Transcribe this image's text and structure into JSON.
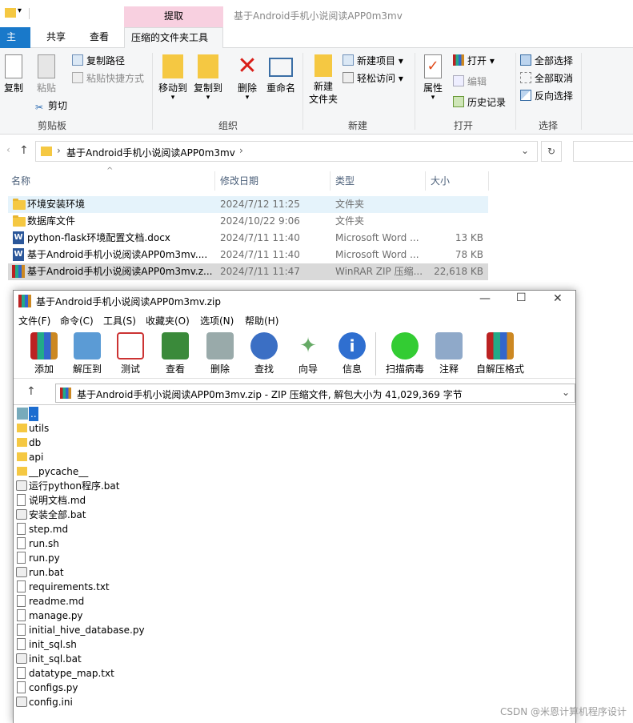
{
  "explorer": {
    "context_tab": "提取",
    "window_title": "基于Android手机小说阅读APP0m3mv",
    "tabs": [
      "主页",
      "共享",
      "查看",
      "压缩的文件夹工具"
    ],
    "ribbon": {
      "clipboard": {
        "copy": "复制",
        "paste": "粘贴",
        "copy_path": "复制路径",
        "paste_shortcut": "粘贴快捷方式",
        "cut": "剪切",
        "label": "剪贴板"
      },
      "organize": {
        "move_to": "移动到",
        "copy_to": "复制到",
        "delete": "删除",
        "rename": "重命名",
        "label": "组织"
      },
      "new": {
        "new_folder_line1": "新建",
        "new_folder_line2": "文件夹",
        "new_item": "新建项目",
        "easy_access": "轻松访问",
        "label": "新建"
      },
      "open": {
        "properties": "属性",
        "open": "打开",
        "edit": "编辑",
        "history": "历史记录",
        "label": "打开"
      },
      "select": {
        "select_all": "全部选择",
        "select_none": "全部取消",
        "invert": "反向选择",
        "label": "选择"
      }
    },
    "address": "基于Android手机小说阅读APP0m3mv",
    "columns": {
      "name": "名称",
      "date": "修改日期",
      "type": "类型",
      "size": "大小"
    },
    "files": [
      {
        "name": "环境安装环境",
        "date": "2024/7/12 11:25",
        "type": "文件夹",
        "size": "",
        "icon": "folder"
      },
      {
        "name": "数据库文件",
        "date": "2024/10/22 9:06",
        "type": "文件夹",
        "size": "",
        "icon": "folder"
      },
      {
        "name": "python-flask环境配置文档.docx",
        "date": "2024/7/11 11:40",
        "type": "Microsoft Word ...",
        "size": "13 KB",
        "icon": "word"
      },
      {
        "name": "基于Android手机小说阅读APP0m3mv....",
        "date": "2024/7/11 11:40",
        "type": "Microsoft Word ...",
        "size": "78 KB",
        "icon": "word"
      },
      {
        "name": "基于Android手机小说阅读APP0m3mv.z...",
        "date": "2024/7/11 11:47",
        "type": "WinRAR ZIP 压缩...",
        "size": "22,618 KB",
        "icon": "rar"
      }
    ]
  },
  "rar": {
    "title": "基于Android手机小说阅读APP0m3mv.zip",
    "menu": [
      "文件(F)",
      "命令(C)",
      "工具(S)",
      "收藏夹(O)",
      "选项(N)",
      "帮助(H)"
    ],
    "toolbar": [
      "添加",
      "解压到",
      "测试",
      "查看",
      "删除",
      "查找",
      "向导",
      "信息",
      "扫描病毒",
      "注释",
      "自解压格式"
    ],
    "path": "基于Android手机小说阅读APP0m3mv.zip - ZIP 压缩文件, 解包大小为 41,029,369 字节",
    "entries": [
      {
        "name": "..",
        "icon": "up"
      },
      {
        "name": "utils",
        "icon": "folder"
      },
      {
        "name": "db",
        "icon": "folder"
      },
      {
        "name": "api",
        "icon": "folder"
      },
      {
        "name": "__pycache__",
        "icon": "folder"
      },
      {
        "name": "运行python程序.bat",
        "icon": "gear"
      },
      {
        "name": "说明文档.md",
        "icon": "file"
      },
      {
        "name": "安装全部.bat",
        "icon": "gear"
      },
      {
        "name": "step.md",
        "icon": "file"
      },
      {
        "name": "run.sh",
        "icon": "file"
      },
      {
        "name": "run.py",
        "icon": "file"
      },
      {
        "name": "run.bat",
        "icon": "gear"
      },
      {
        "name": "requirements.txt",
        "icon": "file"
      },
      {
        "name": "readme.md",
        "icon": "file"
      },
      {
        "name": "manage.py",
        "icon": "file"
      },
      {
        "name": "initial_hive_database.py",
        "icon": "file"
      },
      {
        "name": "init_sql.sh",
        "icon": "file"
      },
      {
        "name": "init_sql.bat",
        "icon": "gear"
      },
      {
        "name": "datatype_map.txt",
        "icon": "file"
      },
      {
        "name": "configs.py",
        "icon": "file"
      },
      {
        "name": "config.ini",
        "icon": "gear"
      }
    ]
  },
  "watermark": "CSDN @米恩计算机程序设计"
}
